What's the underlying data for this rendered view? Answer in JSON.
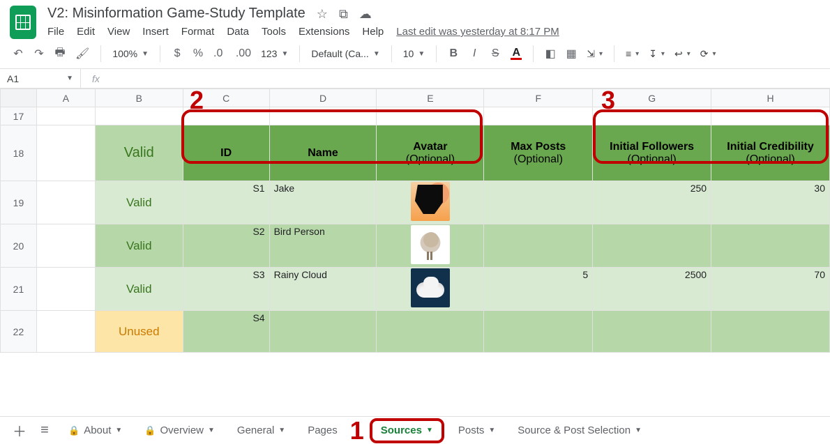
{
  "doc": {
    "title": "V2: Misinformation Game-Study Template",
    "last_edit": "Last edit was yesterday at 8:17 PM"
  },
  "menubar": [
    "File",
    "Edit",
    "View",
    "Insert",
    "Format",
    "Data",
    "Tools",
    "Extensions",
    "Help"
  ],
  "toolbar": {
    "zoom": "100%",
    "font": "Default (Ca...",
    "font_size": "10",
    "num123": "123"
  },
  "fx": {
    "name_box": "A1",
    "fx_label": "fx"
  },
  "columns": [
    "A",
    "B",
    "C",
    "D",
    "E",
    "F",
    "G",
    "H"
  ],
  "row_labels": [
    "17",
    "18",
    "19",
    "20",
    "21",
    "22"
  ],
  "headers": {
    "valid": "Valid",
    "C": {
      "main": "ID"
    },
    "D": {
      "main": "Name"
    },
    "E": {
      "main": "Avatar",
      "sub": "(Optional)"
    },
    "F": {
      "main": "Max Posts",
      "sub": "(Optional)"
    },
    "G": {
      "main": "Initial Followers",
      "sub": "(Optional)"
    },
    "H": {
      "main": "Initial Credibility",
      "sub": "(Optional)"
    }
  },
  "rows": [
    {
      "status": "Valid",
      "id": "S1",
      "name": "Jake",
      "avatar": "jake",
      "max": "",
      "followers": "250",
      "cred": "30"
    },
    {
      "status": "Valid",
      "id": "S2",
      "name": "Bird Person",
      "avatar": "bird",
      "max": "",
      "followers": "",
      "cred": ""
    },
    {
      "status": "Valid",
      "id": "S3",
      "name": "Rainy Cloud",
      "avatar": "cloud",
      "max": "5",
      "followers": "2500",
      "cred": "70"
    },
    {
      "status": "Unused",
      "id": "S4",
      "name": "",
      "avatar": "",
      "max": "",
      "followers": "",
      "cred": ""
    }
  ],
  "callouts": {
    "c1": "1",
    "c2": "2",
    "c3": "3"
  },
  "tabs": {
    "about": "About",
    "overview": "Overview",
    "general": "General",
    "pages": "Pages",
    "sources": "Sources",
    "posts": "Posts",
    "selection": "Source & Post Selection"
  }
}
